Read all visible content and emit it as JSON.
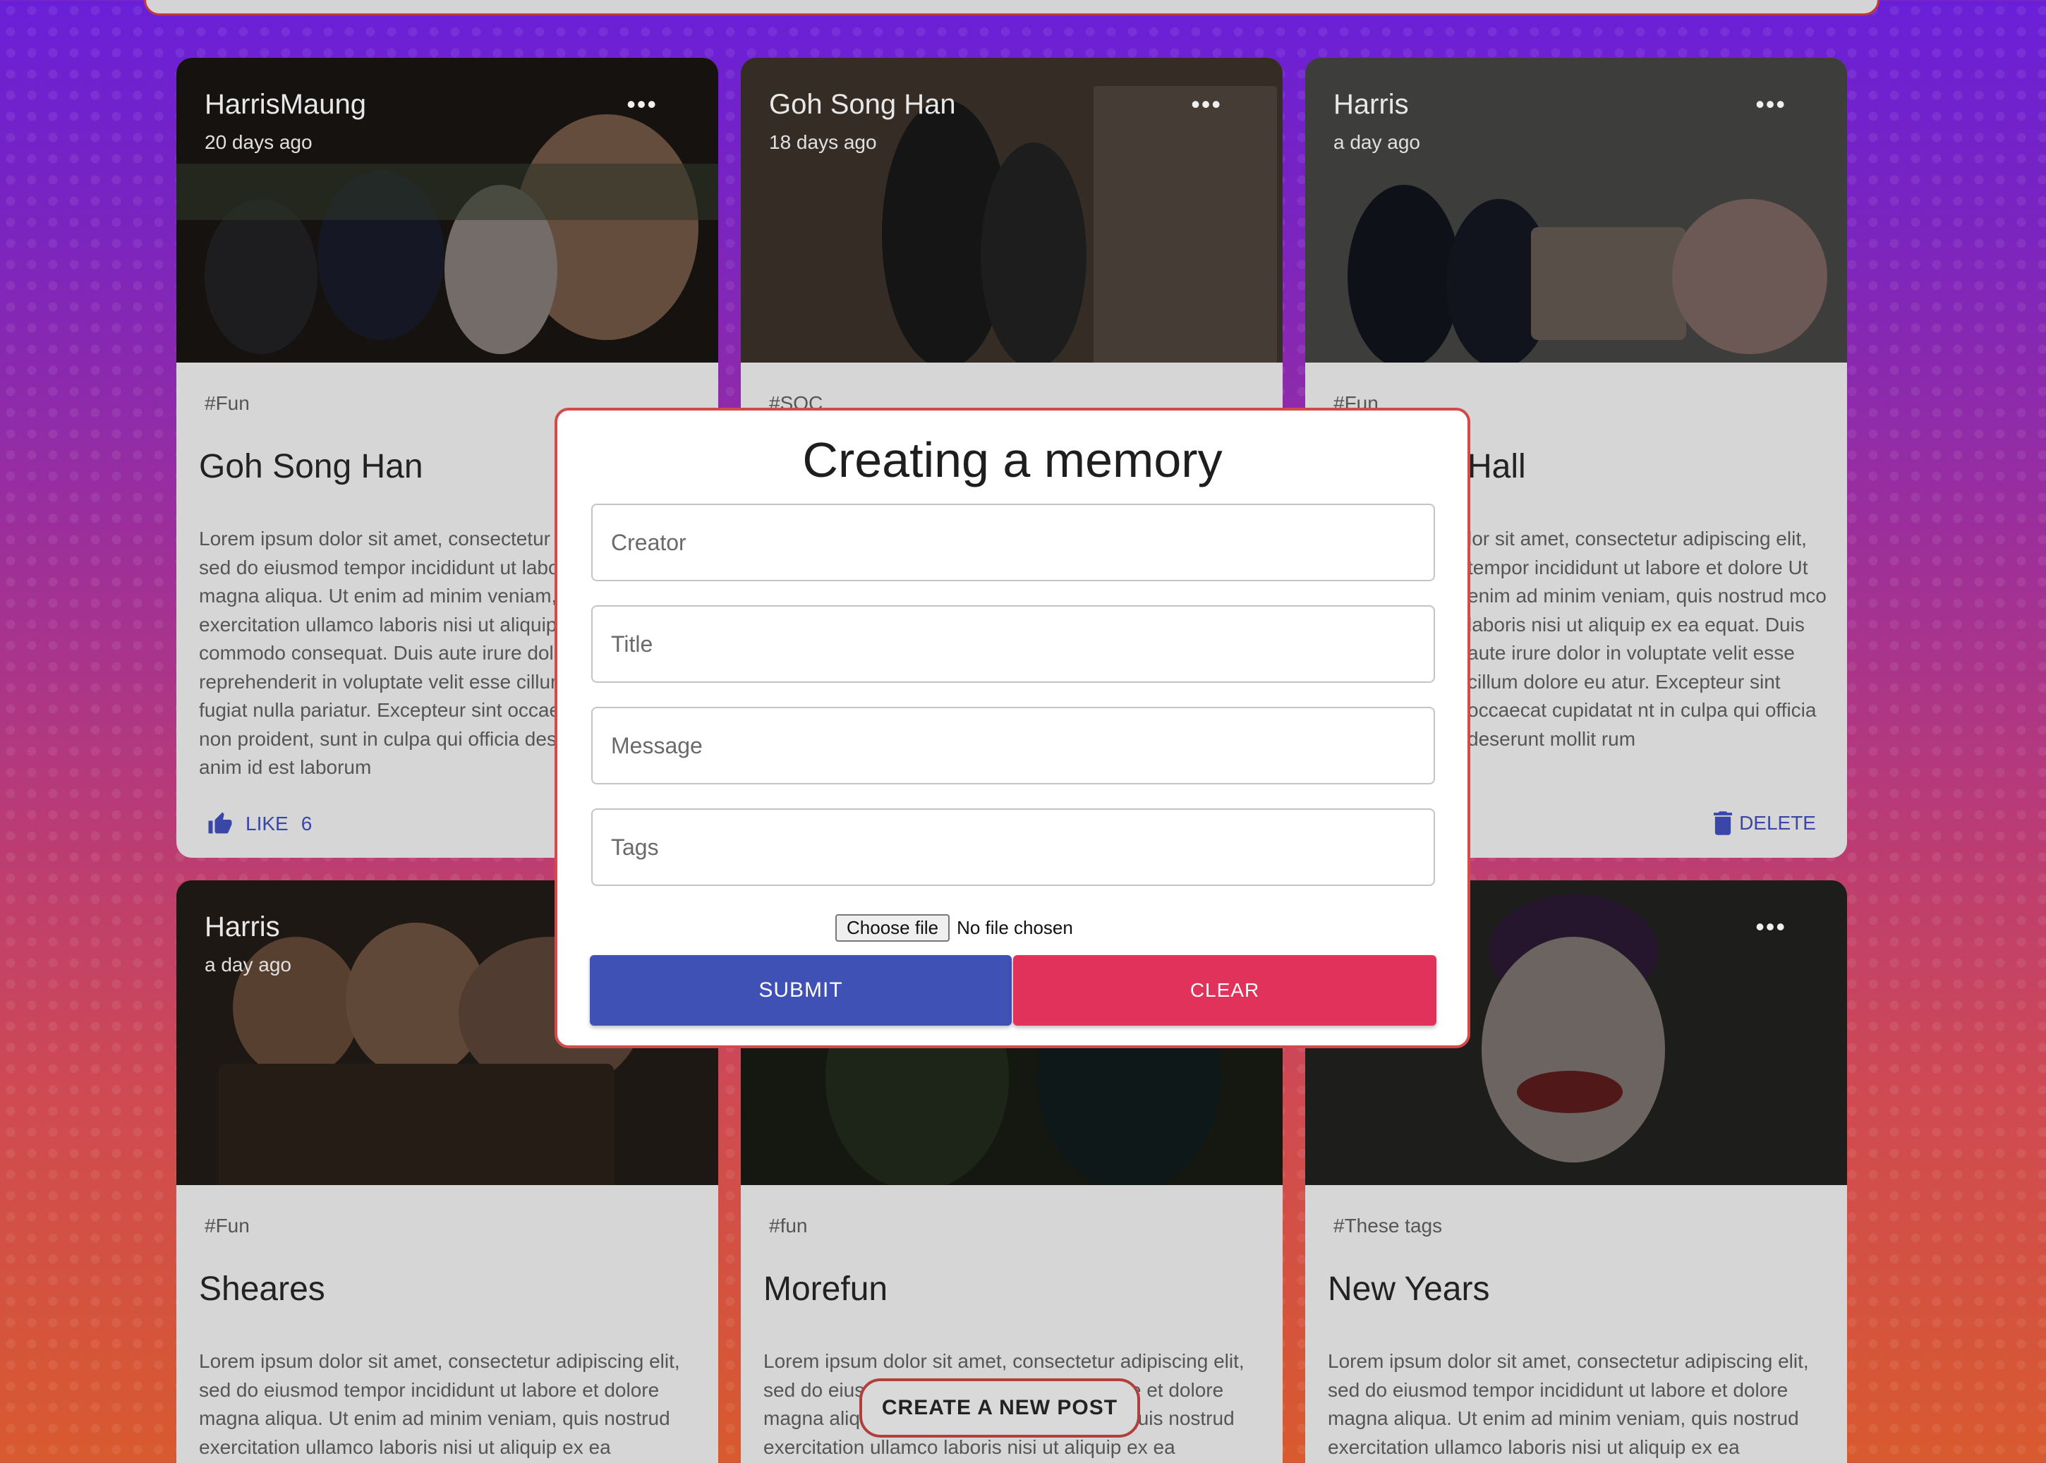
{
  "posts": [
    {
      "creator": "HarrisMaung",
      "time": "20 days ago",
      "tags": "#Fun",
      "title": "Goh Song Han",
      "message": "Lorem ipsum dolor sit amet, consectetur adipiscing elit, sed do eiusmod tempor incididunt ut labore et dolore magna aliqua. Ut enim ad minim veniam, quis nostrud exercitation ullamco laboris nisi ut aliquip ex ea commodo consequat. Duis aute irure dolor in reprehenderit in voluptate velit esse cillum dolore eu fugiat nulla pariatur. Excepteur sint occaecat cupidatat non proident, sunt in culpa qui officia deserunt mollit anim id est laborum",
      "like_label": "LIKE",
      "like_count": "6"
    },
    {
      "creator": "Goh Song Han",
      "time": "18 days ago",
      "tags": "#SOC",
      "title": "",
      "message": ""
    },
    {
      "creator": "Harris",
      "time": "a day ago",
      "tags": "#Fun",
      "title": "Hall",
      "message": "lor sit amet, consectetur adipiscing elit, tempor incididunt ut labore et dolore Ut enim ad minim veniam, quis nostrud mco laboris nisi ut aliquip ex ea equat. Duis aute irure dolor in voluptate velit esse cillum dolore eu atur. Excepteur sint occaecat cupidatat nt in culpa qui officia deserunt mollit rum",
      "delete_label": "DELETE"
    },
    {
      "creator": "Harris",
      "time": "a day ago",
      "tags": "#Fun",
      "title": "Sheares",
      "message": "Lorem ipsum dolor sit amet, consectetur adipiscing elit, sed do eiusmod tempor incididunt ut labore et dolore magna aliqua. Ut enim ad minim veniam, quis nostrud exercitation ullamco laboris nisi ut aliquip ex ea"
    },
    {
      "creator": "",
      "time": "",
      "tags": "#fun",
      "title": "Morefun",
      "message": "Lorem ipsum dolor sit amet, consectetur adipiscing elit, sed do eiusmod tempor incididunt ut labore et dolore magna aliqua. Ut enim ad minim veniam, quis nostrud exercitation ullamco laboris nisi ut aliquip ex ea"
    },
    {
      "creator": "",
      "time": "",
      "tags": "#These tags",
      "title": "New Years",
      "message": "Lorem ipsum dolor sit amet, consectetur adipiscing elit, sed do eiusmod tempor incididunt ut labore et dolore magna aliqua. Ut enim ad minim veniam, quis nostrud exercitation ullamco laboris nisi ut aliquip ex ea"
    }
  ],
  "more_glyph": "•••",
  "form": {
    "title": "Creating a memory",
    "creator_placeholder": "Creator",
    "title_placeholder": "Title",
    "message_placeholder": "Message",
    "tags_placeholder": "Tags",
    "file_button": "Choose file",
    "file_status": "No file chosen",
    "submit_label": "SUBMIT",
    "clear_label": "CLEAR"
  },
  "fab_label": "CREATE A NEW POST",
  "colors": {
    "primary": "#3f51b5",
    "secondary": "#e0325a",
    "modal_border": "#d44a48"
  }
}
